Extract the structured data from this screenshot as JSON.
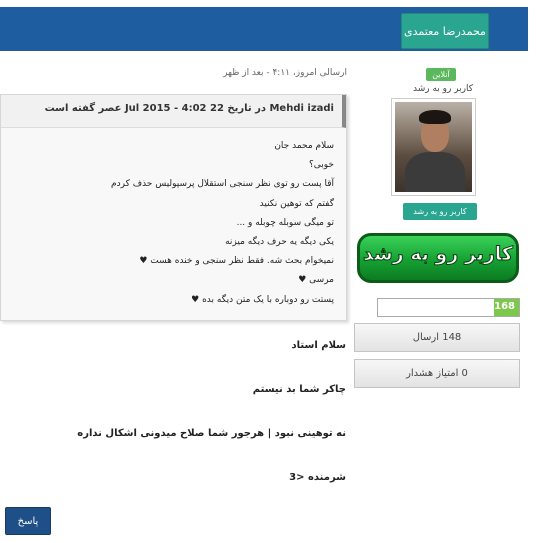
{
  "header": {
    "username": "محمدرضا معتمدی"
  },
  "post": {
    "meta": "ارسالی امروز، ۴:۱۱ - بعد از ظهر"
  },
  "author": {
    "status": "آنلاین",
    "rank_text": "کاربر رو به رشد",
    "rank_badge": "کاربر رو به رشد",
    "rank_banner": "کاربر رو به رشد",
    "reputation": "168",
    "reputation_fraction": 0.18,
    "posts": "148 ارسال",
    "warnings": "0 امتیاز هشدار"
  },
  "quote": {
    "header": "Mehdi izadi در تاریخ 22 Jul 2015 - 4:02 عصر گفته است",
    "lines": [
      "سلام محمد جان",
      "خوبی؟",
      "آقا پست رو توی نظر سنجی استقلال پرسپولیس حذف کردم",
      "گفتم که توهین نکنید",
      "تو میگی سوبله چوبله و ...",
      "یکی دیگه یه حرف دیگه میزنه",
      "نمیخوام بحث شه. فقط نظر سنجی و خنده هست ♥",
      "مرسی ♥",
      "پستت رو دوباره با یک متن دیگه بده ♥"
    ]
  },
  "reply": {
    "lines": [
      "سلام استاد",
      "چاکر شما بد نیستم",
      "نه توهینی نبود | هرجور شما صلاح میدونی اشکال نداره",
      "شرمنده <3"
    ]
  },
  "actions": {
    "reply_label": "پاسخ"
  },
  "colors": {
    "topbar": "#1e5da0",
    "teal": "#2aa58f",
    "green": "#5cb85c",
    "reply_button": "#1e4f86"
  }
}
